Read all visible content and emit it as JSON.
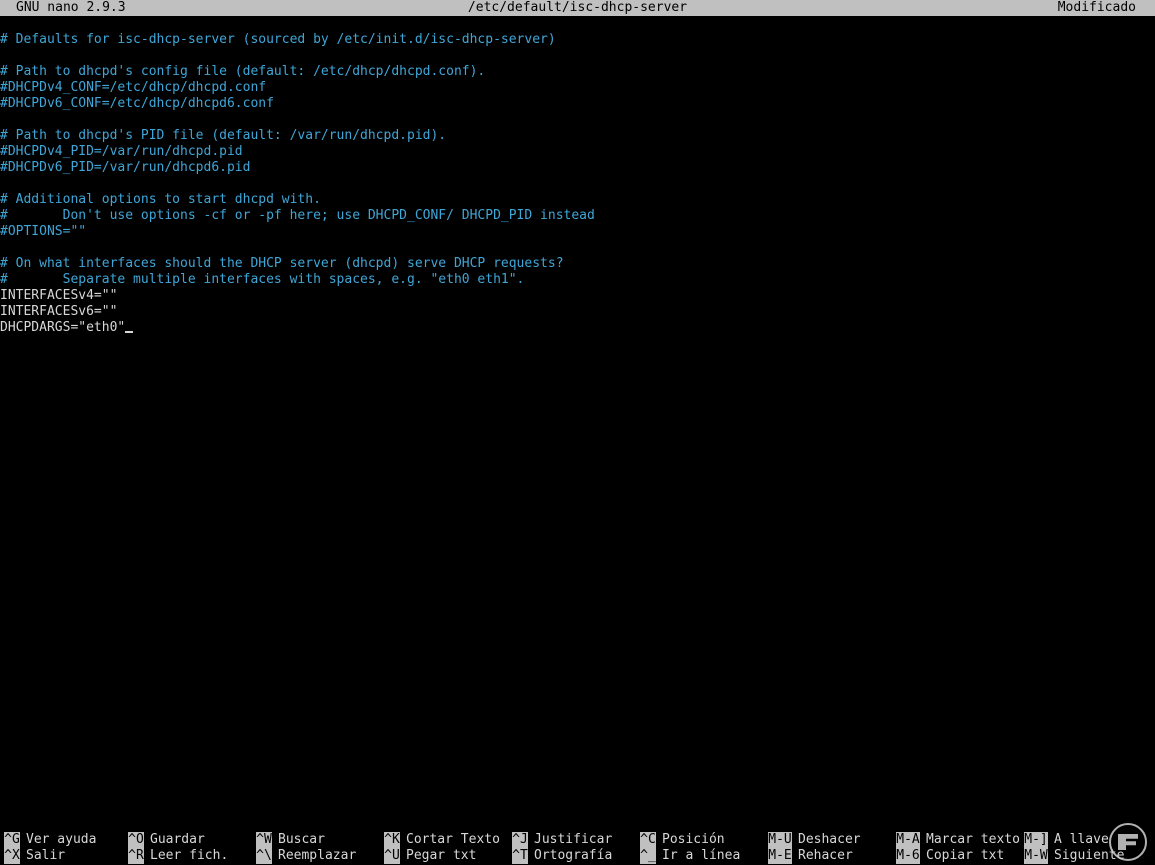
{
  "titlebar": {
    "app": "GNU nano 2.9.3",
    "file": "/etc/default/isc-dhcp-server",
    "status": "Modificado"
  },
  "editor": {
    "lines": [
      {
        "text": "# Defaults for isc-dhcp-server (sourced by /etc/init.d/isc-dhcp-server)",
        "kind": "comment"
      },
      {
        "text": "",
        "kind": "code"
      },
      {
        "text": "# Path to dhcpd's config file (default: /etc/dhcp/dhcpd.conf).",
        "kind": "comment"
      },
      {
        "text": "#DHCPDv4_CONF=/etc/dhcp/dhcpd.conf",
        "kind": "comment"
      },
      {
        "text": "#DHCPDv6_CONF=/etc/dhcp/dhcpd6.conf",
        "kind": "comment"
      },
      {
        "text": "",
        "kind": "code"
      },
      {
        "text": "# Path to dhcpd's PID file (default: /var/run/dhcpd.pid).",
        "kind": "comment"
      },
      {
        "text": "#DHCPDv4_PID=/var/run/dhcpd.pid",
        "kind": "comment"
      },
      {
        "text": "#DHCPDv6_PID=/var/run/dhcpd6.pid",
        "kind": "comment"
      },
      {
        "text": "",
        "kind": "code"
      },
      {
        "text": "# Additional options to start dhcpd with.",
        "kind": "comment"
      },
      {
        "text": "#       Don't use options -cf or -pf here; use DHCPD_CONF/ DHCPD_PID instead",
        "kind": "comment"
      },
      {
        "text": "#OPTIONS=\"\"",
        "kind": "comment"
      },
      {
        "text": "",
        "kind": "code"
      },
      {
        "text": "# On what interfaces should the DHCP server (dhcpd) serve DHCP requests?",
        "kind": "comment"
      },
      {
        "text": "#       Separate multiple interfaces with spaces, e.g. \"eth0 eth1\".",
        "kind": "comment"
      },
      {
        "text": "INTERFACESv4=\"\"",
        "kind": "code"
      },
      {
        "text": "INTERFACESv6=\"\"",
        "kind": "code"
      },
      {
        "text": "DHCPDARGS=\"eth0\"",
        "kind": "code",
        "cursor": true
      }
    ]
  },
  "shortcuts": [
    {
      "key": "^G",
      "label": "Ver ayuda"
    },
    {
      "key": "^X",
      "label": "Salir"
    },
    {
      "key": "^O",
      "label": "Guardar"
    },
    {
      "key": "^R",
      "label": "Leer fich."
    },
    {
      "key": "^W",
      "label": "Buscar"
    },
    {
      "key": "^\\",
      "label": "Reemplazar"
    },
    {
      "key": "^K",
      "label": "Cortar Texto"
    },
    {
      "key": "^U",
      "label": "Pegar txt"
    },
    {
      "key": "^J",
      "label": "Justificar"
    },
    {
      "key": "^T",
      "label": "Ortografía"
    },
    {
      "key": "^C",
      "label": "Posición"
    },
    {
      "key": "^_",
      "label": "Ir a línea"
    },
    {
      "key": "M-U",
      "label": "Deshacer"
    },
    {
      "key": "M-E",
      "label": "Rehacer"
    },
    {
      "key": "M-A",
      "label": "Marcar texto"
    },
    {
      "key": "M-6",
      "label": "Copiar txt"
    },
    {
      "key": "M-]",
      "label": "A llave"
    },
    {
      "key": "M-W",
      "label": "Siguiente"
    }
  ],
  "colors": {
    "comment": "#3fa6d8",
    "text": "#d8d8d8",
    "bar": "#c0c0c0",
    "background": "#000000"
  },
  "watermark": {
    "icon": "site-logo-icon"
  }
}
